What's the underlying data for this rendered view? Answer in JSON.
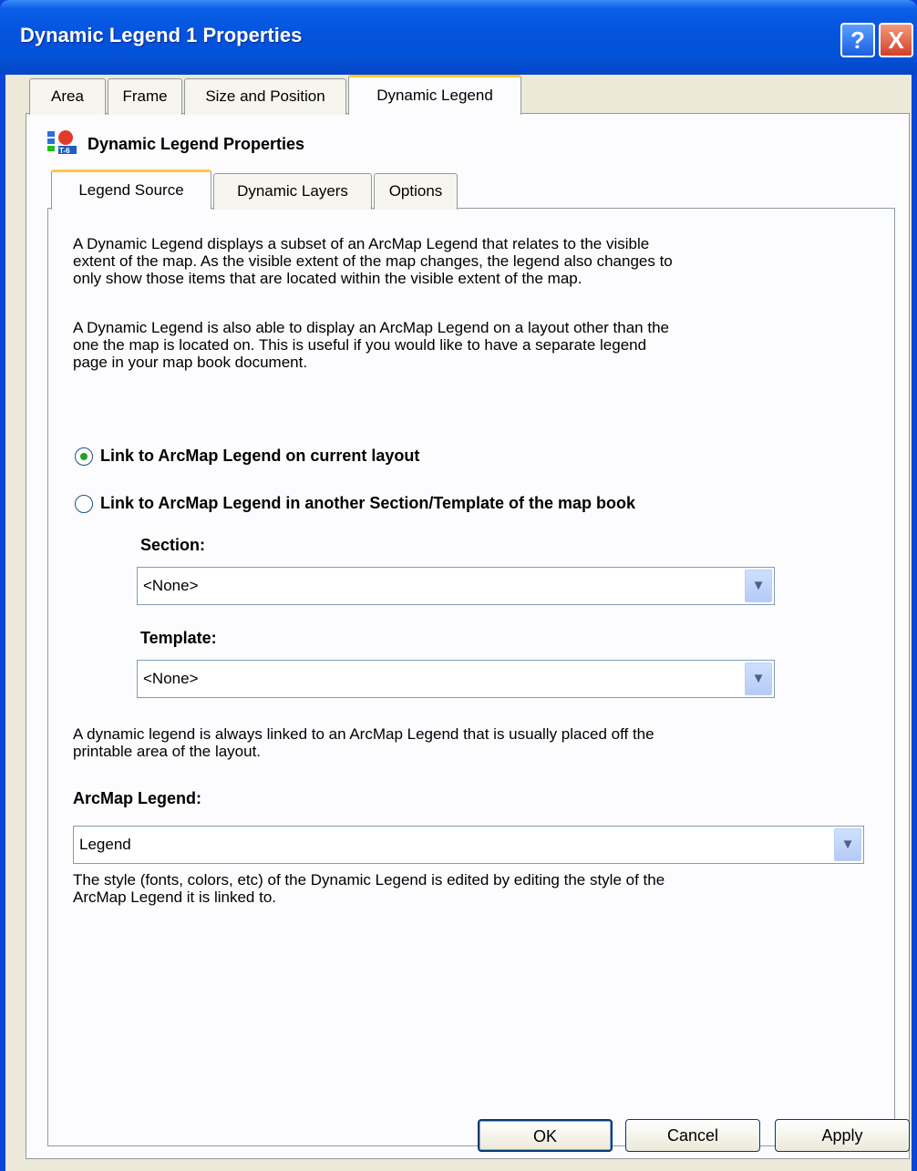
{
  "window": {
    "title": "Dynamic Legend 1 Properties",
    "help_label": "?",
    "close_label": "X"
  },
  "outer_tabs": [
    {
      "label": "Area"
    },
    {
      "label": "Frame"
    },
    {
      "label": "Size and Position"
    },
    {
      "label": "Dynamic Legend"
    }
  ],
  "panel": {
    "header": "Dynamic Legend Properties",
    "icon_text": "T-6"
  },
  "inner_tabs": [
    {
      "label": "Legend Source"
    },
    {
      "label": "Dynamic Layers"
    },
    {
      "label": "Options"
    }
  ],
  "content": {
    "para1_line1": "A Dynamic Legend displays a subset of an ArcMap Legend that relates to the visible",
    "para1_line2": "extent of the map.  As the visible extent of the map changes, the legend also changes to",
    "para1_line3": "only show those items that are located within the visible extent of the map.",
    "para2_line1": "A Dynamic Legend is also able to display an ArcMap Legend on a layout other than the",
    "para2_line2": "one the map is located on.  This is useful if you would like to have a separate legend",
    "para2_line3": "page in your map book document.",
    "radio1": "Link to ArcMap Legend on current layout",
    "radio2": "Link  to ArcMap Legend in another Section/Template of the map book",
    "section_label": "Section:",
    "section_value": "<None>",
    "template_label": "Template:",
    "template_value": "<None>",
    "para3_line1": "A dynamic legend is always linked to an ArcMap Legend that is usually placed off the",
    "para3_line2": "printable area of the layout.",
    "arcmap_label": "ArcMap Legend:",
    "arcmap_value": "Legend",
    "para4_line1": "The style (fonts, colors, etc) of the Dynamic Legend is edited by editing the style of the",
    "para4_line2": "ArcMap Legend it is linked to."
  },
  "buttons": {
    "ok": "OK",
    "cancel": "Cancel",
    "apply": "Apply"
  },
  "colors": {
    "titlebar": "#0453de",
    "dialog_bg": "#ece9d8",
    "active_tab_accent": "#ffc83c",
    "radio_selected": "#21a121"
  }
}
